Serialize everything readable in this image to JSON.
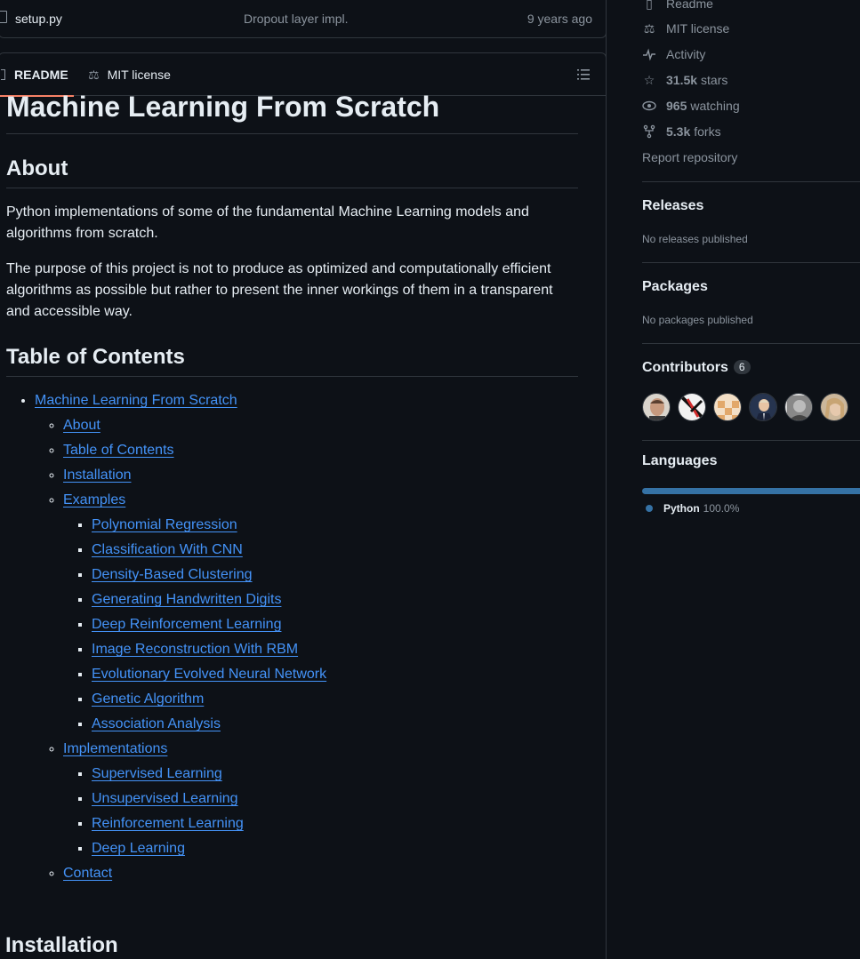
{
  "file_row": {
    "name": "setup.py",
    "message": "Dropout layer impl.",
    "age": "9 years ago"
  },
  "readme_tabs": {
    "readme": "README",
    "license": "MIT license"
  },
  "readme": {
    "title": "Machine Learning From Scratch",
    "about_heading": "About",
    "about_p1": "Python implementations of some of the fundamental Machine Learning models and algorithms from scratch.",
    "about_p2": "The purpose of this project is not to produce as optimized and computationally efficient algorithms as possible but rather to present the inner workings of them in a transparent and accessible way.",
    "toc_heading": "Table of Contents",
    "toc": {
      "root": "Machine Learning From Scratch",
      "about": "About",
      "table_of_contents": "Table of Contents",
      "installation": "Installation",
      "examples": "Examples",
      "example_items": [
        "Polynomial Regression",
        "Classification With CNN",
        "Density-Based Clustering",
        "Generating Handwritten Digits",
        "Deep Reinforcement Learning",
        "Image Reconstruction With RBM",
        "Evolutionary Evolved Neural Network",
        "Genetic Algorithm",
        "Association Analysis"
      ],
      "implementations": "Implementations",
      "implementation_items": [
        "Supervised Learning",
        "Unsupervised Learning",
        "Reinforcement Learning",
        "Deep Learning"
      ],
      "contact": "Contact"
    },
    "installation_heading": "Installation"
  },
  "sidebar": {
    "readme_link": "Readme",
    "license_link": "MIT license",
    "activity_link": "Activity",
    "stars_count": "31.5k",
    "stars_label": "stars",
    "watching_count": "965",
    "watching_label": "watching",
    "forks_count": "5.3k",
    "forks_label": "forks",
    "report": "Report repository",
    "releases_heading": "Releases",
    "releases_empty": "No releases published",
    "packages_heading": "Packages",
    "packages_empty": "No packages published",
    "contributors_heading": "Contributors",
    "contributors_count": "6",
    "languages_heading": "Languages",
    "language_name": "Python",
    "language_pct": "100.0%",
    "language_share": 100,
    "language_color": "#3572a5"
  },
  "colors": {
    "link": "#4493f8",
    "accent_underline": "#f78166",
    "background": "#0d1117",
    "border": "#30363d"
  }
}
